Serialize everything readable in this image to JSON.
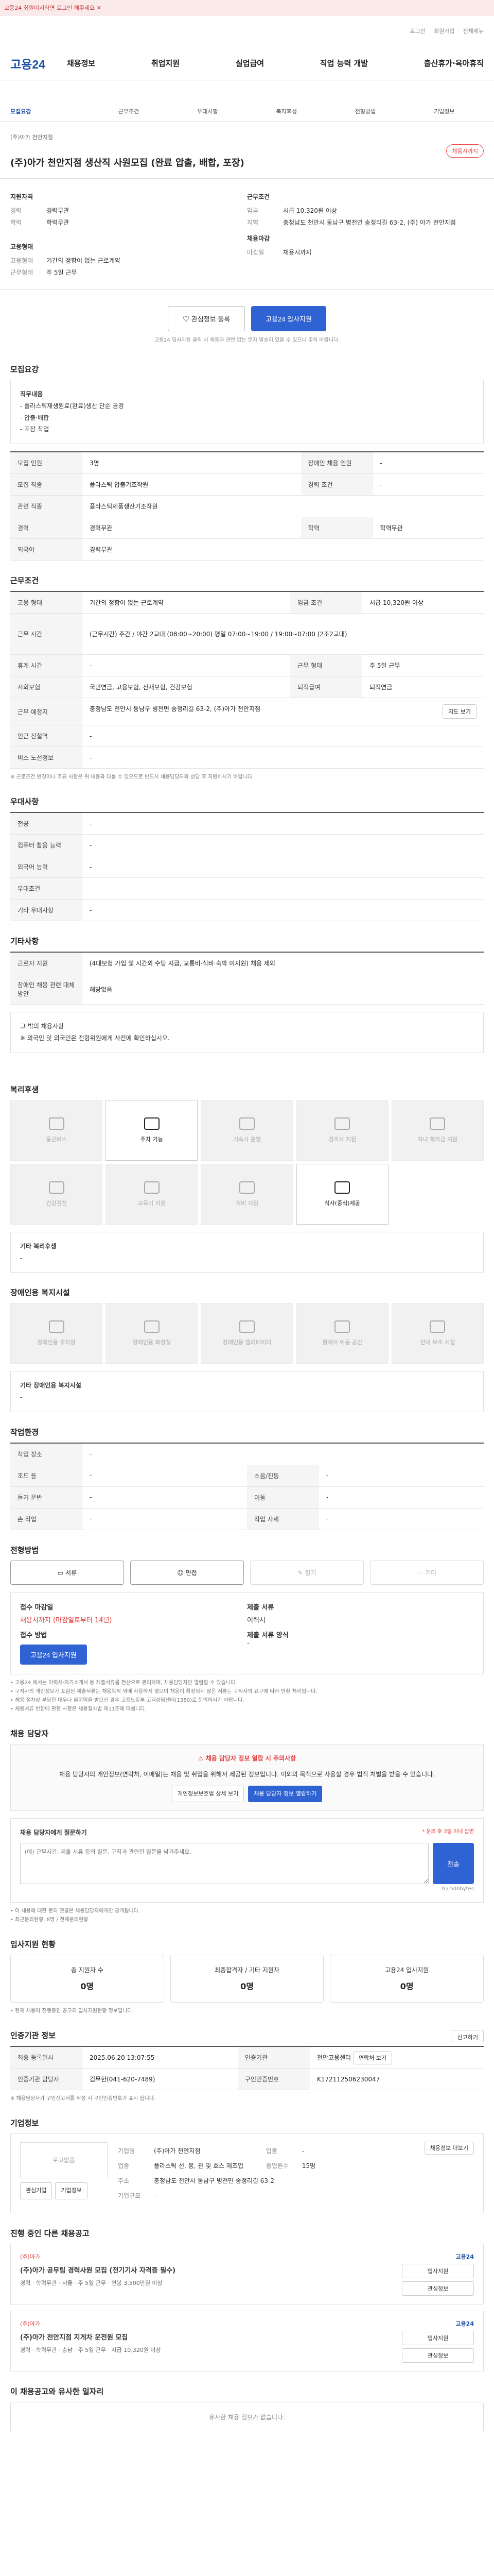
{
  "banner": {
    "text": "고용24 회원이시라면 로그인 해주세요 ✕"
  },
  "util": {
    "links": [
      "로그인",
      "회원가입",
      "전체메뉴"
    ]
  },
  "logo": {
    "text": "고용24"
  },
  "gnb": {
    "items": [
      "채용정보",
      "취업지원",
      "실업급여",
      "직업 능력 개발",
      "출산휴가·육아휴직"
    ]
  },
  "subnav": {
    "items": [
      "모집요강",
      "근무조건",
      "우대사항",
      "복지후생",
      "전형방법",
      "기업정보"
    ]
  },
  "title": {
    "company_small": "(주)아가 천안지점",
    "text": "(주)아가 천안지점 생산직 사원모집 (완료 압출, 배합, 포장)",
    "badge": "채용시까지"
  },
  "summary": {
    "left_heading": "지원자격",
    "left": [
      {
        "k": "경력",
        "v": "경력무관"
      },
      {
        "k": "학력",
        "v": "학력무관"
      }
    ],
    "left2_heading": "고용형태",
    "left2": [
      {
        "k": "고용형태",
        "v": "기간의 정함이 없는 근로계약"
      },
      {
        "k": "근무형태",
        "v": "주 5일 근무"
      }
    ],
    "right_heading": "근무조건",
    "right": [
      {
        "k": "임금",
        "v": "시급 10,320원 이상"
      },
      {
        "k": "지역",
        "v": "충청남도 천안시 동남구 병천면 송정리길 63-2, (주) 아가 천안지점"
      }
    ],
    "right2_heading": "채용마감",
    "right2": [
      {
        "k": "마감일",
        "v": "채용시까지"
      }
    ]
  },
  "actions": {
    "scrap": "관심정보 등록",
    "apply": "고용24 입사지원",
    "note": "고용24 입사지원 클릭 시 채용과 관련 없는 문자 발송이 있을 수 있으니 주의 바랍니다."
  },
  "recruit": {
    "title": "모집요강",
    "duty_heading": "직무내용",
    "duty_lines": [
      "- 플라스틱재생원료(완료)생산 단순 공정",
      "- 압출·배합",
      "- 포장 작업"
    ],
    "rows": [
      {
        "th": "모집 인원",
        "td": "3명",
        "th2": "장애인 채용 인원",
        "td2": "-"
      },
      {
        "th": "모집 직종",
        "td": "플라스틱 압출기조작원",
        "th2": "경력 조건",
        "td2": "-"
      },
      {
        "th": "관련 직종",
        "td": "플라스틱제품생산기조작원",
        "th2": "",
        "td2": ""
      },
      {
        "th": "경력",
        "td": "경력무관",
        "th2": "학력",
        "td2": "학력무관"
      },
      {
        "th": "외국어",
        "td": "경력무관",
        "th2": "",
        "td2": ""
      }
    ]
  },
  "work": {
    "title": "근무조건",
    "rows": [
      {
        "th": "고용 형태",
        "td": "기간의 정함이 없는 근로계약",
        "th2": "임금 조건",
        "td2": "시급 10,320원 이상"
      },
      {
        "th": "근무 시간",
        "td": "(근무시간) 주간 / 야간 2교대 (08:00~20:00) 평일 07:00~19:00 / 19:00~07:00 (2조2교대)",
        "th2": "",
        "td2": ""
      },
      {
        "th": "휴게 시간",
        "td": "-",
        "th2": "근무 형태",
        "td2": "주 5일 근무"
      },
      {
        "th": "사회보험",
        "td": "국민연금, 고용보험, 산재보험, 건강보험",
        "th2": "퇴직급여",
        "td2": "퇴직연금"
      },
      {
        "th": "근무 예정지",
        "td": "충청남도 천안시 동남구 병천면 송정리길 63-2, (주)아가 천안지점",
        "th2": "",
        "td2": ""
      },
      {
        "th": "인근 전철역",
        "td": "-",
        "th2": "",
        "td2": ""
      },
      {
        "th": "버스 노선정보",
        "td": "-",
        "th2": "",
        "td2": ""
      }
    ],
    "map_button": "지도 보기",
    "note": "※ 근로조건 변경이나 주요 사항은 위 내용과 다를 수 있으므로 반드시 채용담당자와 상담 후 지원하시기 바랍니다."
  },
  "prefer": {
    "title": "우대사항",
    "rows": [
      {
        "th": "전공",
        "td": "-"
      },
      {
        "th": "컴퓨터 활용 능력",
        "td": "-"
      },
      {
        "th": "외국어 능력",
        "td": "-"
      },
      {
        "th": "우대조건",
        "td": "-"
      },
      {
        "th": "기타 우대사항",
        "td": "-"
      }
    ]
  },
  "etc": {
    "title": "기타사항",
    "rows": [
      {
        "th": "근로자 지원",
        "td": "(4대보험 가입 및 시간외 수당 지급, 교통비·식비·숙박 미지원) 채용 제외"
      },
      {
        "th": "장애인 채용 관련 대체 방안",
        "td": "해당없음"
      }
    ],
    "box_lines": [
      "그 밖의 채용사항",
      "※ 외국인 및 외국인은 전형위원에게 사전에 확인하십시오."
    ]
  },
  "welfare": {
    "title": "복리후생",
    "items": [
      {
        "name": "통근버스",
        "on": false
      },
      {
        "name": "주차 가능",
        "on": true
      },
      {
        "name": "기숙사 운영",
        "on": false
      },
      {
        "name": "경조사 지원",
        "on": false
      },
      {
        "name": "자녀 학자금 지원",
        "on": false
      },
      {
        "name": "건강검진",
        "on": false
      },
      {
        "name": "교육비 지원",
        "on": false
      },
      {
        "name": "식비 지원",
        "on": false
      },
      {
        "name": "식사(중식)제공",
        "on": true
      },
      {
        "name": "",
        "on": false
      }
    ],
    "extra_label": "기타 복리후생",
    "extra_value": "-"
  },
  "disability": {
    "title": "장애인용 복지시설",
    "items": [
      "장애인용 주차장",
      "장애인용 화장실",
      "장애인용 엘리베이터",
      "휠체어 이동 공간",
      "안내 보조 시설"
    ],
    "extra_label": "기타 장애인용 복지시설",
    "extra_value": "-"
  },
  "workenv": {
    "title": "작업환경",
    "rows": [
      {
        "th": "작업 장소",
        "td": "-",
        "th2": "",
        "td2": ""
      },
      {
        "th": "조도 등",
        "td": "-",
        "th2": "소음/진동",
        "td2": "-"
      },
      {
        "th": "들기 운반",
        "td": "-",
        "th2": "이동",
        "td2": "-"
      },
      {
        "th": "손 작업",
        "td": "-",
        "th2": "작업 자세",
        "td2": "-"
      }
    ]
  },
  "selection": {
    "title": "전형방법",
    "methods": [
      {
        "name": "서류",
        "on": true
      },
      {
        "name": "면접",
        "on": true
      },
      {
        "name": "필기",
        "on": false
      },
      {
        "name": "기타",
        "on": false
      }
    ],
    "deadline_label": "접수 마감일",
    "deadline_value": "채용시까지",
    "deadline_note": "(마감일로부터 14년)",
    "how_label": "접수 방법",
    "how_value": "고용24 입사지원",
    "docs_label": "제출 서류",
    "docs_value": "이력서",
    "form_label": "제출 서류 양식",
    "form_value": "-",
    "apply_button": "고용24 입사지원",
    "notes": [
      "• 고용24 에서는 이력서·자기소개서 등 제출서류를 전산으로 관리하며, 채용담당자만 열람할 수 있습니다.",
      "• 구직자의 개인정보가 포함된 제출서류는 채용목적 외에 사용하지 않으며 채용이 확정되지 않은 서류는 구직자의 요구에 따라 반환 처리됩니다.",
      "• 채용 절차상 부당한 대우나 불이익을 받으신 경우 고용노동부 고객상담센터(1350)로 문의하시기 바랍니다.",
      "• 채용서류 반환에 관한 사항은 채용절차법 제11조에 따릅니다."
    ]
  },
  "contact": {
    "title": "채용 담당자",
    "alert_title": "채용 담당자 정보 열람 시 주의사항",
    "alert_text": "채용 담당자의 개인정보(연락처, 이메일)는 채용 및 취업을 위해서 제공된 정보입니다. 이외의 목적으로 사용할 경우 법적 처벌을 받을 수 있습니다.",
    "btn1": "개인정보보호법 상세 보기",
    "btn2": "채용 담당자 정보 열람하기",
    "inquiry_title": "채용 담당자에게 질문하기",
    "inquiry_note": "* 문의 후 3일 이내 답변",
    "inquiry_placeholder": "(예) 근무시간, 제출 서류 등의 질문, 구직과 관련된 질문을 남겨주세요.",
    "counter": "0 / 500bytes",
    "submit": "전송",
    "notes": [
      "• 이 채용에 대한 문의 댓글은 채용담당자에게만 공개됩니다.",
      "• 최근문의현황: 8명 / 전체문의현황 "
    ]
  },
  "applicants": {
    "title": "입사지원 현황",
    "stats": [
      {
        "label": "총 지원자 수",
        "value": "0명"
      },
      {
        "label": "최종합격자 / 기타 지원자",
        "value": "0명"
      },
      {
        "label": "고용24 입사지원",
        "value": "0명"
      }
    ],
    "note": "• 현재 채용이 진행중인 공고의 입사지원현황 정보입니다."
  },
  "recruit_info": {
    "title": "인증기관 정보",
    "report_button": "신고하기",
    "rows": [
      {
        "th": "최종 등록일시",
        "td": "2025.06.20 13:07:55",
        "th2": "인증기관",
        "td2": "천안고용센터",
        "btn2": "연락처 보기"
      },
      {
        "th": "인증기관 담당자",
        "td": "김무한(041-620-7489)",
        "th2": "구인인증번호",
        "td2": "K172112506230047"
      }
    ],
    "note": "※ 채용담당자가 구인신고서를 작성 시 구인인증번호가 표시 됩니다."
  },
  "company": {
    "title": "기업정보",
    "logo_text": "로고없음",
    "btn_interest": "관심기업",
    "btn_more": "기업정보",
    "rows": [
      {
        "th": "기업명",
        "td": "(주)아가 천안지점",
        "th2": "업종",
        "td2": "-"
      },
      {
        "th": "업종",
        "td": "플라스틱 선, 봉, 관 및 호스 제조업",
        "th2": "종업원수",
        "td2": "15명"
      },
      {
        "th": "주소",
        "td": "충청남도 천안시 동남구 병천면 송정리길 63-2",
        "th2": "",
        "td2": ""
      },
      {
        "th": "기업규모",
        "td": "-",
        "th2": "",
        "td2": ""
      }
    ],
    "company_button": "채용정보 더보기"
  },
  "others": {
    "title": "진행 중인 다른 채용공고",
    "cards": [
      {
        "company": "(주)아가",
        "title": "(주)아가 공무팀 경력사원 모집 (전기기사 자격증 필수)",
        "meta": [
          "경력",
          "학력무관",
          "서울",
          "주 5일 근무",
          "연봉 3,500만원 이상"
        ],
        "logo": "고용24",
        "btns": [
          "입사지원",
          "관심정보"
        ]
      },
      {
        "company": "(주)아가",
        "title": "(주)아가 천안지점 지게차 운전원 모집",
        "meta": [
          "경력",
          "학력무관",
          "충남",
          "주 5일 근무",
          "시급 10,320원 이상"
        ],
        "logo": "고용24",
        "btns": [
          "입사지원",
          "관심정보"
        ]
      }
    ]
  },
  "recommend": {
    "title": "이 채용공고와 유사한 일자리",
    "empty": "유사한 채용 정보가 없습니다."
  }
}
